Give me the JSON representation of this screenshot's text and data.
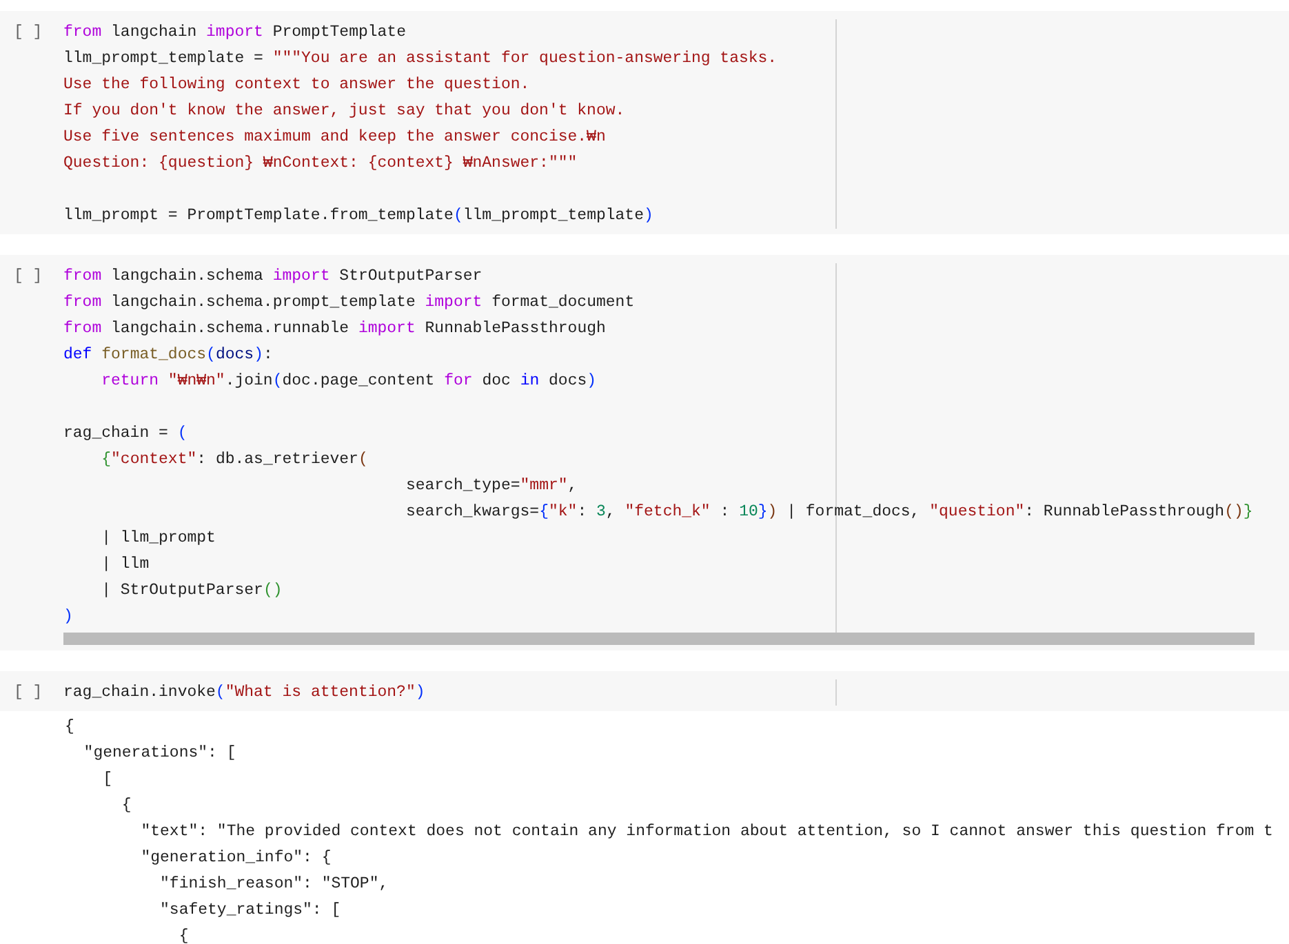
{
  "cells": [
    {
      "run_button": "[ ]",
      "scrollbar": false,
      "lines": [
        {
          "kind": "code",
          "tokens": [
            {
              "kind": "keyword",
              "text": "from"
            },
            {
              "kind": "plain",
              "text": " langchain "
            },
            {
              "kind": "keyword",
              "text": "import"
            },
            {
              "kind": "plain",
              "text": " PromptTemplate"
            }
          ]
        },
        {
          "kind": "code",
          "tokens": [
            {
              "kind": "plain",
              "text": "llm_prompt_template = "
            },
            {
              "kind": "string",
              "text": "\"\"\"You are an assistant for question-answering tasks."
            }
          ]
        },
        {
          "kind": "code",
          "tokens": [
            {
              "kind": "string",
              "text": "Use the following context to answer the question."
            }
          ]
        },
        {
          "kind": "code",
          "tokens": [
            {
              "kind": "string",
              "text": "If you don't know the answer, just say that you don't know."
            }
          ]
        },
        {
          "kind": "code",
          "tokens": [
            {
              "kind": "string",
              "text": "Use five sentences maximum and keep the answer concise.₩n"
            }
          ]
        },
        {
          "kind": "code",
          "tokens": [
            {
              "kind": "string",
              "text": "Question: {question} ₩nContext: {context} ₩nAnswer:\"\"\""
            }
          ]
        },
        {
          "kind": "blank"
        },
        {
          "kind": "code",
          "tokens": [
            {
              "kind": "plain",
              "text": "llm_prompt = PromptTemplate.from_template"
            },
            {
              "kind": "paren",
              "text": "("
            },
            {
              "kind": "plain",
              "text": "llm_prompt_template"
            },
            {
              "kind": "paren",
              "text": ")"
            }
          ]
        }
      ]
    },
    {
      "run_button": "[ ]",
      "scrollbar": true,
      "lines": [
        {
          "kind": "code",
          "tokens": [
            {
              "kind": "keyword",
              "text": "from"
            },
            {
              "kind": "plain",
              "text": " langchain.schema "
            },
            {
              "kind": "keyword",
              "text": "import"
            },
            {
              "kind": "plain",
              "text": " StrOutputParser"
            }
          ]
        },
        {
          "kind": "code",
          "tokens": [
            {
              "kind": "keyword",
              "text": "from"
            },
            {
              "kind": "plain",
              "text": " langchain.schema.prompt_template "
            },
            {
              "kind": "keyword",
              "text": "import"
            },
            {
              "kind": "plain",
              "text": " format_document"
            }
          ]
        },
        {
          "kind": "code",
          "tokens": [
            {
              "kind": "keyword",
              "text": "from"
            },
            {
              "kind": "plain",
              "text": " langchain.schema.runnable "
            },
            {
              "kind": "keyword",
              "text": "import"
            },
            {
              "kind": "plain",
              "text": " RunnablePassthrough"
            }
          ]
        },
        {
          "kind": "code",
          "tokens": [
            {
              "kind": "def",
              "text": "def"
            },
            {
              "kind": "function",
              "text": " format_docs"
            },
            {
              "kind": "paren",
              "text": "("
            },
            {
              "kind": "param",
              "text": "docs"
            },
            {
              "kind": "paren",
              "text": ")"
            },
            {
              "kind": "plain",
              "text": ":"
            }
          ]
        },
        {
          "kind": "code",
          "tokens": [
            {
              "kind": "keyword",
              "text": "    return"
            },
            {
              "kind": "string",
              "text": " \"₩n₩n\""
            },
            {
              "kind": "plain",
              "text": ".join"
            },
            {
              "kind": "paren",
              "text": "("
            },
            {
              "kind": "plain",
              "text": "doc.page_content "
            },
            {
              "kind": "keyword",
              "text": "for"
            },
            {
              "kind": "plain",
              "text": " doc "
            },
            {
              "kind": "def",
              "text": "in"
            },
            {
              "kind": "plain",
              "text": " docs"
            },
            {
              "kind": "paren",
              "text": ")"
            }
          ]
        },
        {
          "kind": "blank"
        },
        {
          "kind": "code",
          "tokens": [
            {
              "kind": "plain",
              "text": "rag_chain = "
            },
            {
              "kind": "paren",
              "text": "("
            }
          ]
        },
        {
          "kind": "code",
          "tokens": [
            {
              "kind": "brace",
              "text": "    {"
            },
            {
              "kind": "string",
              "text": "\"context\""
            },
            {
              "kind": "plain",
              "text": ": db.as_retriever"
            },
            {
              "kind": "call",
              "text": "("
            }
          ]
        },
        {
          "kind": "code",
          "tokens": [
            {
              "kind": "plain",
              "text": "                                    search_type="
            },
            {
              "kind": "string",
              "text": "\"mmr\""
            },
            {
              "kind": "plain",
              "text": ","
            }
          ]
        },
        {
          "kind": "code",
          "tokens": [
            {
              "kind": "plain",
              "text": "                                    search_kwargs="
            },
            {
              "kind": "paren",
              "text": "{"
            },
            {
              "kind": "string",
              "text": "\"k\""
            },
            {
              "kind": "plain",
              "text": ": "
            },
            {
              "kind": "number",
              "text": "3"
            },
            {
              "kind": "plain",
              "text": ", "
            },
            {
              "kind": "string",
              "text": "\"fetch_k\""
            },
            {
              "kind": "plain",
              "text": " : "
            },
            {
              "kind": "number",
              "text": "10"
            },
            {
              "kind": "paren",
              "text": "}"
            },
            {
              "kind": "call",
              "text": ")"
            },
            {
              "kind": "plain",
              "text": " | format_docs, "
            },
            {
              "kind": "string",
              "text": "\"question\""
            },
            {
              "kind": "plain",
              "text": ": RunnablePassthrough"
            },
            {
              "kind": "call",
              "text": "()"
            },
            {
              "kind": "brace",
              "text": "}"
            }
          ]
        },
        {
          "kind": "code",
          "tokens": [
            {
              "kind": "plain",
              "text": "    | llm_prompt"
            }
          ]
        },
        {
          "kind": "code",
          "tokens": [
            {
              "kind": "plain",
              "text": "    | llm"
            }
          ]
        },
        {
          "kind": "code",
          "tokens": [
            {
              "kind": "plain",
              "text": "    | StrOutputParser"
            },
            {
              "kind": "brace",
              "text": "()"
            }
          ]
        },
        {
          "kind": "code",
          "tokens": [
            {
              "kind": "paren",
              "text": ")"
            }
          ]
        }
      ]
    },
    {
      "run_button": "[ ]",
      "scrollbar": false,
      "lines": [
        {
          "kind": "code",
          "tokens": [
            {
              "kind": "plain",
              "text": "rag_chain.invoke"
            },
            {
              "kind": "paren",
              "text": "("
            },
            {
              "kind": "string",
              "text": "\"What is attention?\""
            },
            {
              "kind": "paren",
              "text": ")"
            }
          ]
        }
      ],
      "output": [
        "{",
        "  \"generations\": [",
        "    [",
        "      {",
        "        \"text\": \"The provided context does not contain any information about attention, so I cannot answer this question from t",
        "        \"generation_info\": {",
        "          \"finish_reason\": \"STOP\",",
        "          \"safety_ratings\": [",
        "            {"
      ]
    }
  ]
}
